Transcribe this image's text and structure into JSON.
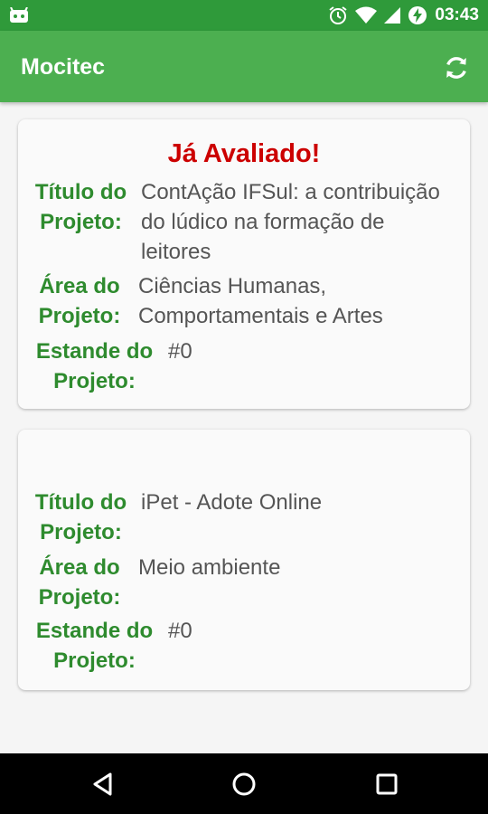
{
  "status_bar": {
    "time": "03:43",
    "icons": [
      "android-debug-icon",
      "alarm-icon",
      "wifi-icon",
      "signal-icon",
      "battery-charging-icon"
    ]
  },
  "app_bar": {
    "title": "Mocitec",
    "refresh_icon": "refresh-icon"
  },
  "labels": {
    "title": "Título do Projeto:",
    "area": "Área do Projeto:",
    "stand": "Estande do Projeto:"
  },
  "projects": [
    {
      "status": "Já Avaliado!",
      "title": "ContAção IFSul: a contribuição do lúdico na formação de leitores",
      "area": "Ciências Humanas, Comportamentais e Artes",
      "stand": "#0"
    },
    {
      "status": "",
      "title": "iPet - Adote Online",
      "area": "Meio ambiente",
      "stand": "#0"
    }
  ],
  "nav_bar": {
    "icons": [
      "back-icon",
      "home-icon",
      "recents-icon"
    ]
  },
  "colors": {
    "primary": "#4caf50",
    "primary_dark": "#2f9a3a",
    "status_red": "#cc0000",
    "label_green": "#2e8b2e"
  }
}
